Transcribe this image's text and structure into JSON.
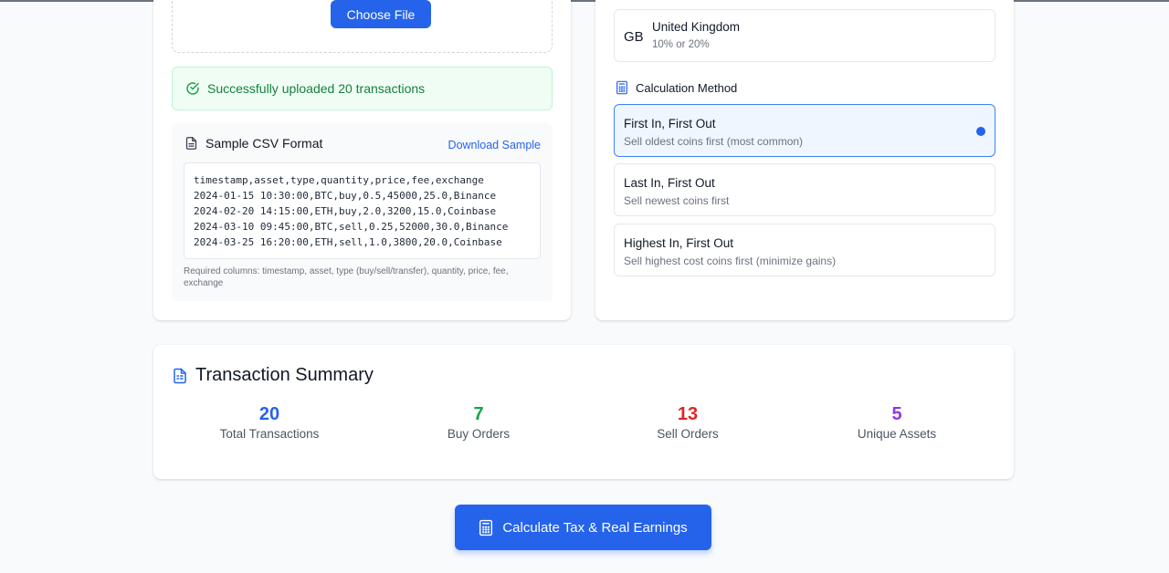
{
  "upload": {
    "choose_file_label": "Choose File",
    "success_message": "Successfully uploaded 20 transactions"
  },
  "sample": {
    "title": "Sample CSV Format",
    "download_label": "Download Sample",
    "csv_lines": [
      "timestamp,asset,type,quantity,price,fee,exchange",
      "2024-01-15 10:30:00,BTC,buy,0.5,45000,25.0,Binance",
      "2024-02-20 14:15:00,ETH,buy,2.0,3200,15.0,Coinbase",
      "2024-03-10 09:45:00,BTC,sell,0.25,52000,30.0,Binance",
      "2024-03-25 16:20:00,ETH,sell,1.0,3800,20.0,Coinbase"
    ],
    "required_note": "Required columns: timestamp, asset, type (buy/sell/transfer), quantity, price, fee, exchange"
  },
  "country": {
    "code": "GB",
    "name": "United Kingdom",
    "rate": "10% or 20%"
  },
  "calculation": {
    "title": "Calculation Method",
    "methods": [
      {
        "name": "First In, First Out",
        "description": "Sell oldest coins first (most common)",
        "selected": true
      },
      {
        "name": "Last In, First Out",
        "description": "Sell newest coins first",
        "selected": false
      },
      {
        "name": "Highest In, First Out",
        "description": "Sell highest cost coins first (minimize gains)",
        "selected": false
      }
    ]
  },
  "summary": {
    "title": "Transaction Summary",
    "stats": [
      {
        "value": "20",
        "label": "Total Transactions",
        "color": "#2563eb"
      },
      {
        "value": "7",
        "label": "Buy Orders",
        "color": "#16a34a"
      },
      {
        "value": "13",
        "label": "Sell Orders",
        "color": "#dc2626"
      },
      {
        "value": "5",
        "label": "Unique Assets",
        "color": "#9333ea"
      }
    ]
  },
  "actions": {
    "calculate_label": "Calculate Tax & Real Earnings"
  },
  "icons": {
    "success": "check-circle-icon",
    "sample": "file-text-icon",
    "method": "calculator-icon",
    "summary": "file-spreadsheet-icon",
    "calculate": "calculator-icon"
  },
  "colors": {
    "accent": "#2563eb",
    "success": "#15803d",
    "success_bg": "#f0fdf4"
  }
}
